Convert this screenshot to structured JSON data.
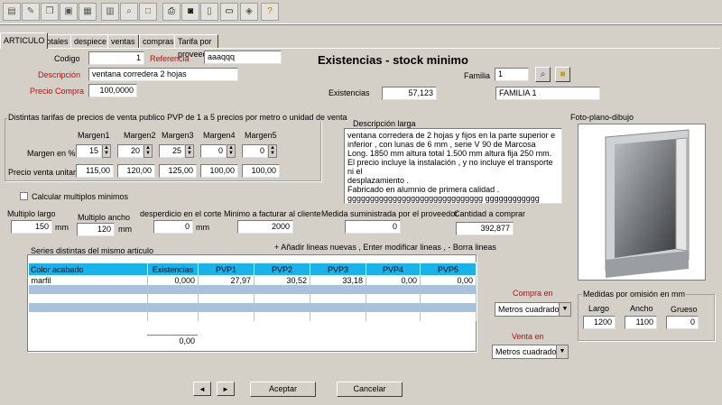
{
  "tabs": [
    "ARTICULO",
    "Totales",
    "despiece",
    "ventas",
    "compras",
    "Tarifa por proveedor"
  ],
  "form_title": "Existencias - stock minimo",
  "codigo": {
    "label": "Codigo",
    "value": "1"
  },
  "referencia": {
    "label": "Referencia",
    "value": "aaaqqq"
  },
  "descripcion": {
    "label": "Descripción",
    "value": "ventana corredera 2 hojas"
  },
  "precio_compra": {
    "label": "Precio Compra",
    "value": "100,0000"
  },
  "familia": {
    "label": "Familia",
    "value": "1",
    "name": "FAMILIA 1"
  },
  "existencias": {
    "label": "Existencias",
    "value": "57,123"
  },
  "tarifas": {
    "title": "Distintas tarifas de precios de venta publico PVP de 1 a 5 precios por metro o unidad de venta",
    "margen_label": "Margen en %",
    "precio_label": "Precio venta unitario",
    "headers": [
      "Margen1",
      "Margen2",
      "Margen3",
      "Margen4",
      "Margen5"
    ],
    "margins": [
      "15",
      "20",
      "25",
      "0",
      "0"
    ],
    "prices": [
      "115,00",
      "120,00",
      "125,00",
      "100,00",
      "100,00"
    ]
  },
  "descripcion_larga": {
    "label": "Descripción larga",
    "lines": [
      "ventana corredera de 2 hojas y fijos en la parte superior e",
      "inferior , con lunas de 6 mm , serie V 90 de Marcosa",
      "Long. 1850 mm altura total 1.500 mm altura fija 250 mm.",
      "El precio incluye la instalación , y no incluye el transporte ni el",
      "desplazamiento .",
      "Fabricado en alumnio de primera calidad .",
      "gggggggggggggggggggggggggggggg gggggggggggg"
    ]
  },
  "foto_label": "Foto-plano-dibujo",
  "calcular_label": "Calcular multiplos minimos",
  "multiplo_largo": {
    "label": "Multiplo largo",
    "value": "150",
    "unit": "mm"
  },
  "multiplo_ancho": {
    "label": "Multiplo ancho",
    "value": "120",
    "unit": "mm"
  },
  "desperdicio": {
    "label": "desperdicio en el corte",
    "value": "0",
    "unit": "mm"
  },
  "minimo_facturar": {
    "label": "Minimo a facturar al cliente",
    "value": "2000"
  },
  "medida_suministrada": {
    "label": "Medida suministrada por el proveedor",
    "value": "0"
  },
  "cantidad_comprar": {
    "label": "Cantidad a comprar",
    "value": "392,877"
  },
  "series_label": "Series distintas del mismo articulo",
  "series_hint": "+ Añadir lineas nuevas , Enter modificar lineas , - Borra lineas",
  "grid": {
    "headers": [
      "Color acabado",
      "Existencias",
      "PVP1",
      "PVP2",
      "PVP3",
      "PVP4",
      "PVP5"
    ],
    "rows": [
      [
        "marfil",
        "0,000",
        "27,97",
        "30,52",
        "33,18",
        "0,00",
        "0,00"
      ]
    ],
    "total": "0,00"
  },
  "compra_en": {
    "label": "Compra en",
    "value": "Metros cuadrados"
  },
  "venta_en": {
    "label": "Venta en",
    "value": "Metros cuadrados"
  },
  "medidas": {
    "title": "Medidas por omisión en mm",
    "largo_label": "Largo",
    "ancho_label": "Ancho",
    "grueso_label": "Grueso",
    "largo": "1200",
    "ancho": "1100",
    "grueso": "0"
  },
  "buttons": {
    "aceptar": "Aceptar",
    "cancelar": "Cancelar",
    "prev": "◄",
    "next": "►"
  },
  "colors": {
    "grid_header": "#19b2eb",
    "grid_alt_row": "#a9c2dc",
    "required_label": "#e00000"
  }
}
